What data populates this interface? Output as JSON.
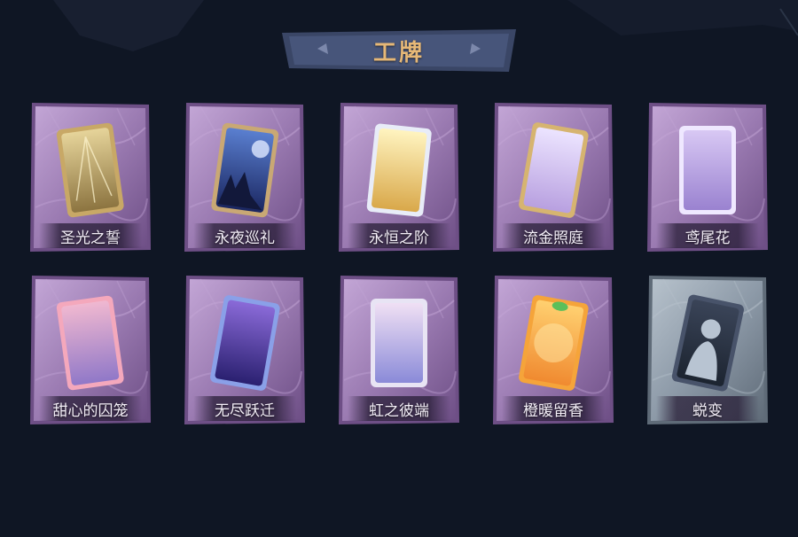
{
  "header": {
    "title": "工牌"
  },
  "colors": {
    "background": "#0f1624",
    "title_gold": "#e6b877",
    "card_purple": "#9a7ab0",
    "card_gray": "#8a9aa8"
  },
  "cards": [
    {
      "label": "圣光之誓",
      "theme": "purple",
      "art": "golden-rays"
    },
    {
      "label": "永夜巡礼",
      "theme": "purple",
      "art": "night-moon"
    },
    {
      "label": "永恒之阶",
      "theme": "purple",
      "art": "golden-light"
    },
    {
      "label": "流金照庭",
      "theme": "purple",
      "art": "gold-frame"
    },
    {
      "label": "鸢尾花",
      "theme": "purple",
      "art": "lavender"
    },
    {
      "label": "甜心的囚笼",
      "theme": "purple",
      "art": "pink-sunset"
    },
    {
      "label": "无尽跃迁",
      "theme": "purple",
      "art": "galaxy"
    },
    {
      "label": "虹之彼端",
      "theme": "purple",
      "art": "rainbow-sky"
    },
    {
      "label": "橙暖留香",
      "theme": "purple",
      "art": "orange"
    },
    {
      "label": "蜕变",
      "theme": "gray",
      "art": "silhouette"
    }
  ]
}
